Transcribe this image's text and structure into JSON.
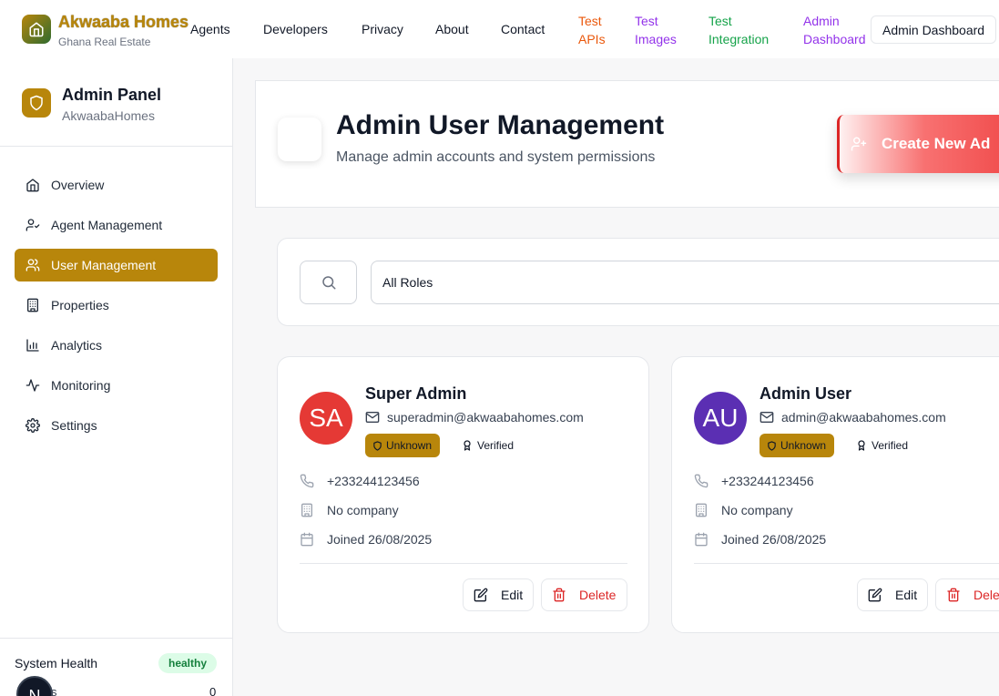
{
  "brand": {
    "name": "Akwaaba Homes",
    "subtitle": "Ghana Real Estate"
  },
  "topnav": {
    "links": [
      {
        "label": "Agents",
        "color": "#111827"
      },
      {
        "label": "Developers",
        "color": "#111827"
      },
      {
        "label": "Privacy",
        "color": "#111827"
      },
      {
        "label": "About",
        "color": "#111827"
      },
      {
        "label": "Contact",
        "color": "#111827"
      },
      {
        "label": "Test APIs",
        "color": "#ea580c"
      },
      {
        "label": "Test Images",
        "color": "#9333ea"
      },
      {
        "label": "Test Integration",
        "color": "#16a34a"
      },
      {
        "label": "Admin Dashboard",
        "color": "#9333ea"
      }
    ],
    "button_label": "Admin Dashboard"
  },
  "sidebar": {
    "title": "Admin Panel",
    "subtitle": "AkwaabaHomes",
    "items": [
      {
        "label": "Overview",
        "icon": "home-icon",
        "active": false
      },
      {
        "label": "Agent Management",
        "icon": "user-check-icon",
        "active": false
      },
      {
        "label": "User Management",
        "icon": "users-icon",
        "active": true
      },
      {
        "label": "Properties",
        "icon": "building-icon",
        "active": false
      },
      {
        "label": "Analytics",
        "icon": "bar-chart-icon",
        "active": false
      },
      {
        "label": "Monitoring",
        "icon": "activity-icon",
        "active": false
      },
      {
        "label": "Settings",
        "icon": "gear-icon",
        "active": false
      }
    ],
    "system_health": {
      "label": "System Health",
      "status": "healthy"
    },
    "partial_row": {
      "label": "s",
      "value": "0"
    },
    "fab_initial": "N"
  },
  "header": {
    "title": "Admin User Management",
    "subtitle": "Manage admin accounts and system permissions",
    "create_button": "Create New Ad"
  },
  "filters": {
    "role_select": "All Roles"
  },
  "users": [
    {
      "initials": "SA",
      "avatar_color": "#e53935",
      "name": "Super Admin",
      "email": "superadmin@akwaabahomes.com",
      "role": "Unknown",
      "verified": "Verified",
      "phone": "+233244123456",
      "company": "No company",
      "joined": "Joined 26/08/2025",
      "edit": "Edit",
      "delete": "Delete"
    },
    {
      "initials": "AU",
      "avatar_color": "#5b2fb3",
      "name": "Admin User",
      "email": "admin@akwaabahomes.com",
      "role": "Unknown",
      "verified": "Verified",
      "phone": "+233244123456",
      "company": "No company",
      "joined": "Joined 26/08/2025",
      "edit": "Edit",
      "delete": "Delete"
    }
  ]
}
